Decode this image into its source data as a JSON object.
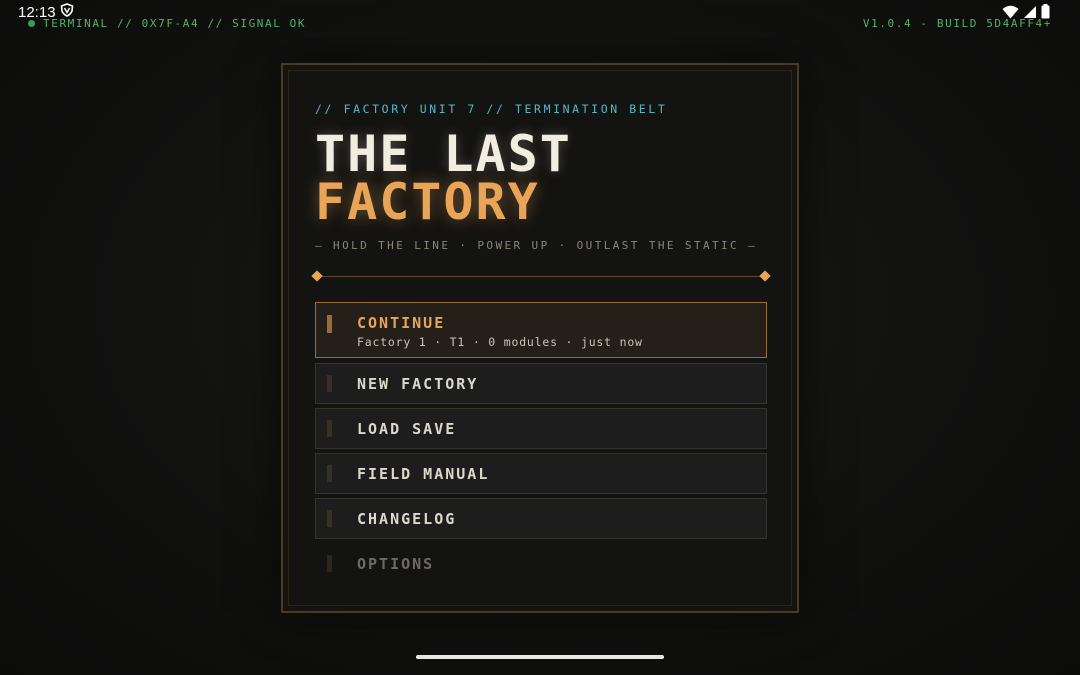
{
  "status_bar": {
    "time": "12:13"
  },
  "hud": {
    "terminal": "TERMINAL // 0X7F-A4 // SIGNAL OK",
    "build": "V1.0.4 - BUILD 5D4AFF4+"
  },
  "panel": {
    "kicker": "// FACTORY UNIT 7 // TERMINATION BELT",
    "title_line1": "THE LAST",
    "title_line2": "FACTORY",
    "tagline": "— HOLD THE LINE · POWER UP · OUTLAST THE STATIC —"
  },
  "menu": {
    "continue": {
      "label": "CONTINUE",
      "sub": "Factory 1 · T1 · 0 modules · just now"
    },
    "new_factory": {
      "label": "NEW FACTORY"
    },
    "load_save": {
      "label": "LOAD SAVE"
    },
    "field_manual": {
      "label": "FIELD MANUAL"
    },
    "changelog": {
      "label": "CHANGELOG"
    },
    "options": {
      "label": "OPTIONS"
    }
  },
  "colors": {
    "accent": "#e8a557",
    "terminal_green": "#4fb46a",
    "kicker_cyan": "#56b7c7"
  }
}
